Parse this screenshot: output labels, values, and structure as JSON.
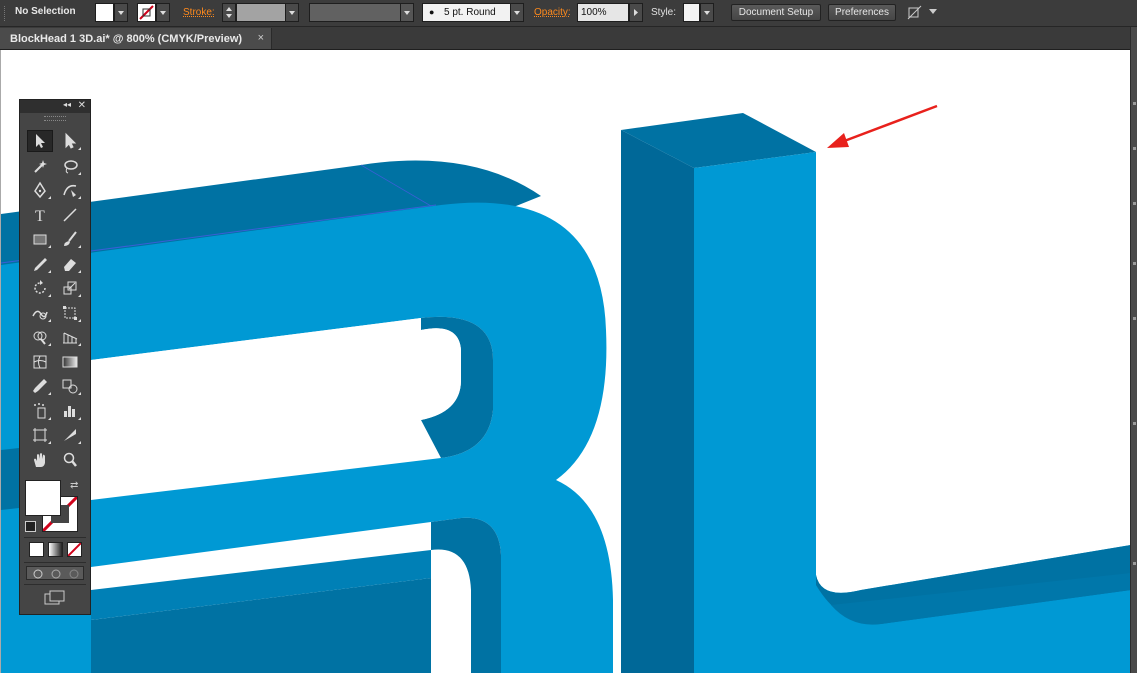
{
  "control_bar": {
    "selection_label": "No Selection",
    "stroke_label": "Stroke:",
    "brush_label": "5 pt. Round",
    "opacity_label": "Opacity:",
    "opacity_value": "100%",
    "style_label": "Style:",
    "document_setup": "Document Setup",
    "preferences": "Preferences"
  },
  "tab": {
    "title": "BlockHead 1 3D.ai* @ 800% (CMYK/Preview)",
    "close": "×"
  },
  "tools_panel": {
    "collapse": "◂◂",
    "close": "✕",
    "tools": [
      {
        "name": "selection-tool-icon"
      },
      {
        "name": "direct-selection-tool-icon"
      },
      {
        "name": "magic-wand-tool-icon"
      },
      {
        "name": "lasso-tool-icon"
      },
      {
        "name": "pen-tool-icon"
      },
      {
        "name": "curvature-tool-icon"
      },
      {
        "name": "type-tool-icon",
        "glyph": "T"
      },
      {
        "name": "line-segment-tool-icon"
      },
      {
        "name": "rectangle-tool-icon"
      },
      {
        "name": "paintbrush-tool-icon"
      },
      {
        "name": "pencil-tool-icon"
      },
      {
        "name": "eraser-tool-icon"
      },
      {
        "name": "rotate-tool-icon"
      },
      {
        "name": "scale-tool-icon"
      },
      {
        "name": "warp-tool-icon"
      },
      {
        "name": "free-transform-tool-icon"
      },
      {
        "name": "shape-builder-tool-icon"
      },
      {
        "name": "perspective-grid-tool-icon"
      },
      {
        "name": "mesh-tool-icon"
      },
      {
        "name": "gradient-tool-icon"
      },
      {
        "name": "eyedropper-tool-icon"
      },
      {
        "name": "blend-tool-icon"
      },
      {
        "name": "symbol-sprayer-tool-icon"
      },
      {
        "name": "column-graph-tool-icon"
      },
      {
        "name": "artboard-tool-icon"
      },
      {
        "name": "slice-tool-icon"
      },
      {
        "name": "hand-tool-icon"
      },
      {
        "name": "zoom-tool-icon"
      }
    ]
  },
  "colors": {
    "front_face": "#0099d4",
    "side_face": "#0072a3",
    "dark_face": "#006898",
    "arrow": "#e8211c",
    "fill_swatch": "#ffffff"
  }
}
